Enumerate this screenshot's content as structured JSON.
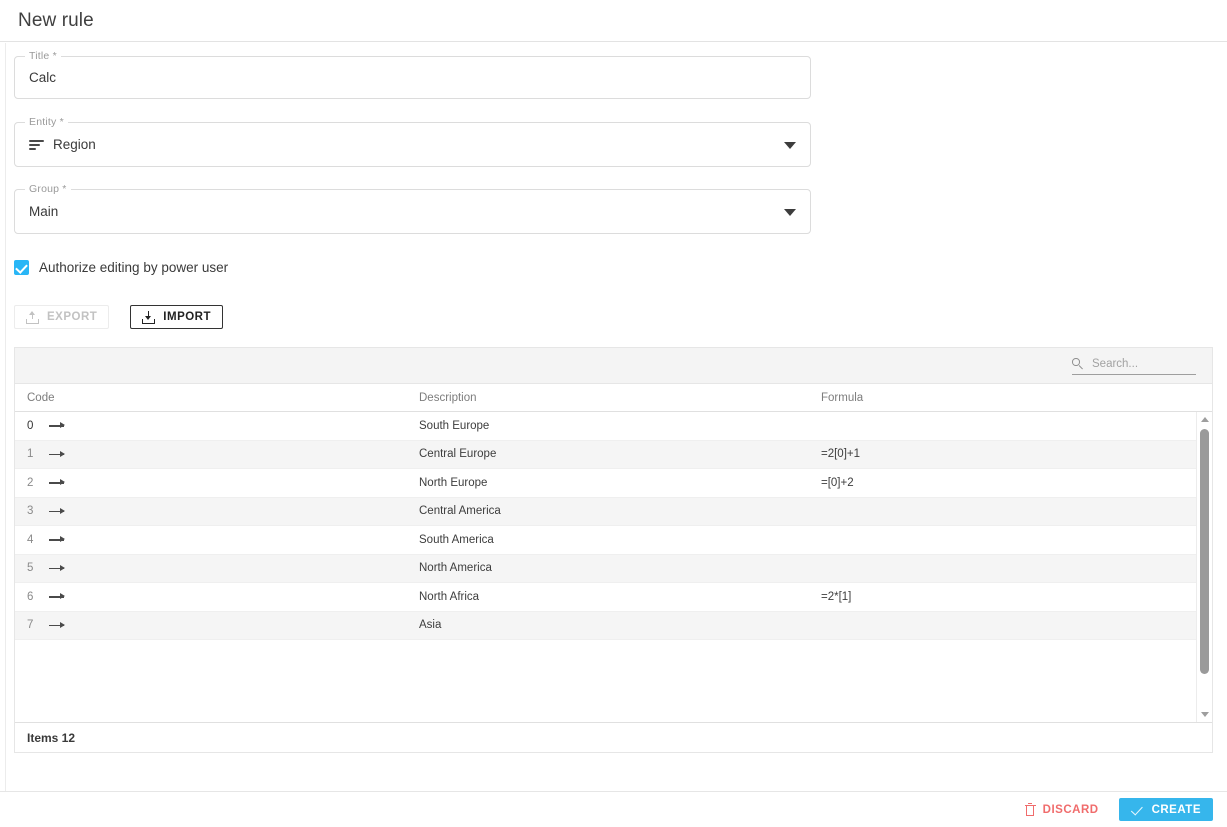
{
  "header": {
    "title": "New rule"
  },
  "form": {
    "title_field": {
      "legend": "Title *",
      "value": "Calc"
    },
    "entity_field": {
      "legend": "Entity *",
      "value": "Region",
      "icon": "list-icon"
    },
    "group_field": {
      "legend": "Group *",
      "value": "Main"
    },
    "checkbox": {
      "label": "Authorize editing by power user",
      "checked": true,
      "color": "#29b6f6"
    }
  },
  "toolbar": {
    "export_label": "EXPORT",
    "import_label": "IMPORT",
    "export_icon": "upload-icon",
    "import_icon": "download-icon",
    "export_disabled": true
  },
  "table": {
    "search": {
      "placeholder": "Search...",
      "value": "",
      "icon": "search-icon"
    },
    "columns": [
      "Code",
      "Description",
      "Formula"
    ],
    "rows": [
      {
        "code": "0",
        "description": "South Europe",
        "formula": ""
      },
      {
        "code": "1",
        "description": "Central Europe",
        "formula": "=2[0]+1"
      },
      {
        "code": "2",
        "description": "North Europe",
        "formula": "=[0]+2"
      },
      {
        "code": "3",
        "description": "Central America",
        "formula": ""
      },
      {
        "code": "4",
        "description": "South America",
        "formula": ""
      },
      {
        "code": "5",
        "description": "North America",
        "formula": ""
      },
      {
        "code": "6",
        "description": "North Africa",
        "formula": "=2*[1]"
      },
      {
        "code": "7",
        "description": "Asia",
        "formula": ""
      }
    ],
    "footer": "Items 12"
  },
  "bottom_bar": {
    "discard_label": "DISCARD",
    "create_label": "CREATE",
    "discard_color": "#f06c6c",
    "create_color": "#36b6ec"
  }
}
